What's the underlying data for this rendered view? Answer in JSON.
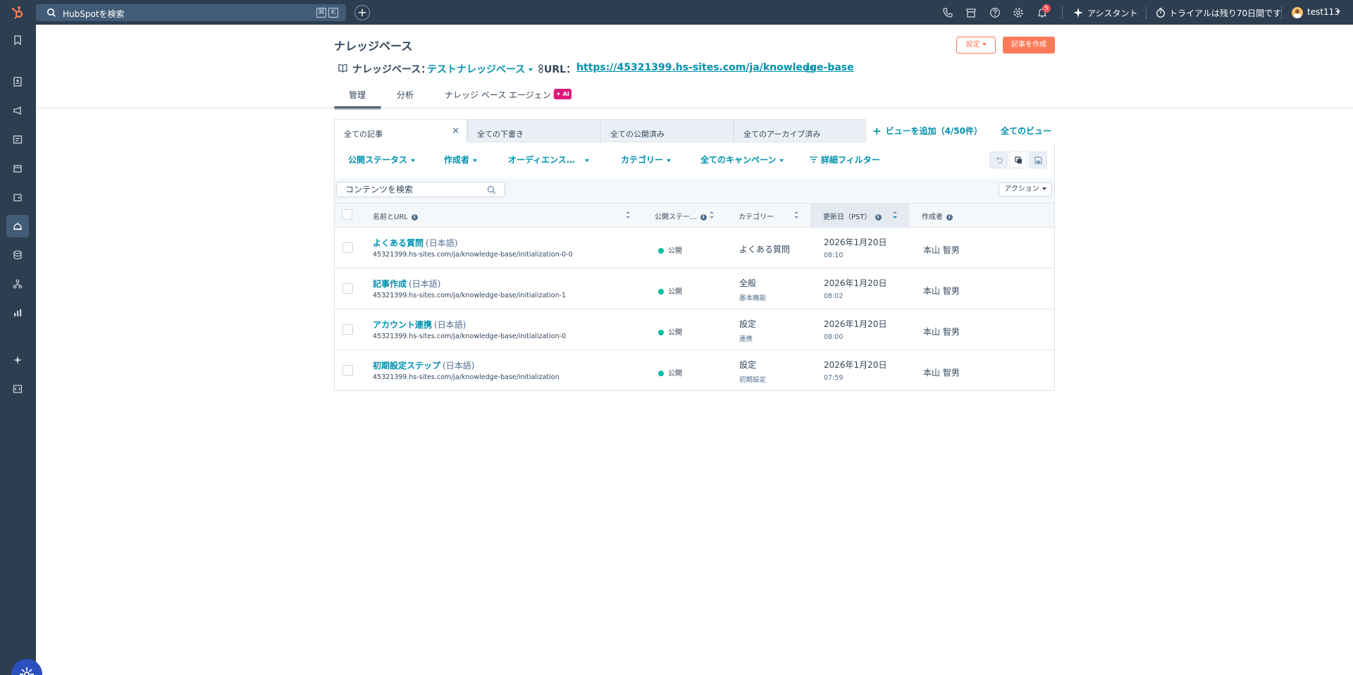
{
  "topbar": {
    "search_placeholder": "HubSpotを検索",
    "kbd1": "⌘",
    "kbd2": "K",
    "notification_count": "5",
    "assistant_label": "アシスタント",
    "trial_label": "トライアルは残り70日間です",
    "account_name": "test113"
  },
  "header": {
    "title": "ナレッジベース",
    "settings_button": "設定",
    "create_button": "記事を作成",
    "kb_label": "ナレッジベース：",
    "kb_value": "テストナレッジベース",
    "url_label": "URL：",
    "url_value": "https://45321399.hs-sites.com/ja/knowledge-base"
  },
  "tabs": {
    "manage": "管理",
    "analytics": "分析",
    "agent": "ナレッジ ベース エージェント",
    "ai_badge": "✦ AI"
  },
  "views": {
    "tabs": [
      "全ての記事",
      "全ての下書き",
      "全ての公開済み",
      "全てのアーカイブ済み"
    ],
    "add_view": "ビューを追加（4/50件）",
    "all_views": "全てのビュー"
  },
  "filters": {
    "status": "公開ステータス",
    "author": "作成者",
    "audience": "オーディエンス…",
    "category": "カテゴリー",
    "campaign": "全てのキャンペーン",
    "advanced": "詳細フィルター"
  },
  "toolbar": {
    "search_placeholder": "コンテンツを検索",
    "actions": "アクション"
  },
  "table": {
    "columns": {
      "name": "名前とURL",
      "status": "公開ステー…",
      "category": "カテゴリー",
      "updated": "更新日（PST）",
      "author": "作成者"
    },
    "rows": [
      {
        "title": "よくある質問",
        "lang": "(日本語)",
        "url": "45321399.hs-sites.com/ja/knowledge-base/initialization-0-0",
        "status": "公開",
        "category": "よくある質問",
        "subcategory": "",
        "date": "2026年1月20日",
        "time": "08:10",
        "author": "本山 智男"
      },
      {
        "title": "記事作成",
        "lang": "(日本語)",
        "url": "45321399.hs-sites.com/ja/knowledge-base/initialization-1",
        "status": "公開",
        "category": "全般",
        "subcategory": "基本機能",
        "date": "2026年1月20日",
        "time": "08:02",
        "author": "本山 智男"
      },
      {
        "title": "アカウント連携",
        "lang": "(日本語)",
        "url": "45321399.hs-sites.com/ja/knowledge-base/initialization-0",
        "status": "公開",
        "category": "設定",
        "subcategory": "連携",
        "date": "2026年1月20日",
        "time": "08:00",
        "author": "本山 智男"
      },
      {
        "title": "初期設定ステップ",
        "lang": "(日本語)",
        "url": "45321399.hs-sites.com/ja/knowledge-base/initialization",
        "status": "公開",
        "category": "設定",
        "subcategory": "初期設定",
        "date": "2026年1月20日",
        "time": "07:59",
        "author": "本山 智男"
      }
    ]
  },
  "colors": {
    "nav_bg": "#2d3e50",
    "link": "#0091ae",
    "accent": "#ff7a59",
    "published_dot": "#00bda5",
    "ai_badge": "#e0187b"
  }
}
